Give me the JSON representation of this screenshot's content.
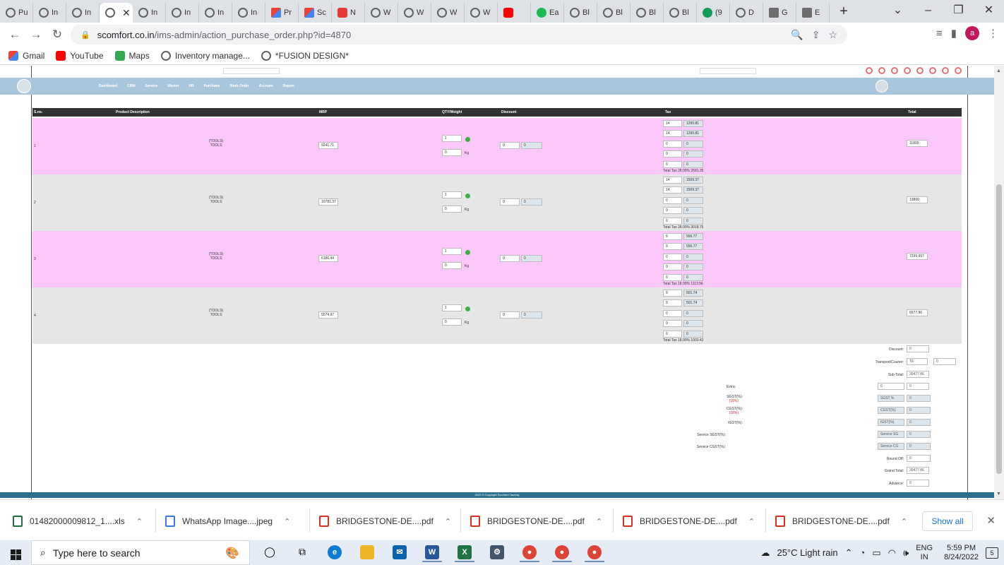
{
  "browser": {
    "tabs": [
      {
        "label": "Pu",
        "icon": "globe-icon"
      },
      {
        "label": "In",
        "icon": "globe-icon"
      },
      {
        "label": "In",
        "icon": "globe-icon"
      },
      {
        "label": "",
        "icon": "globe-icon",
        "active": true
      },
      {
        "label": "In",
        "icon": "globe-icon"
      },
      {
        "label": "In",
        "icon": "globe-icon"
      },
      {
        "label": "In",
        "icon": "globe-icon"
      },
      {
        "label": "In",
        "icon": "globe-icon"
      },
      {
        "label": "Pr",
        "icon": "gmail-icon"
      },
      {
        "label": "Sc",
        "icon": "gmail-icon"
      },
      {
        "label": "N",
        "icon": "red-icon"
      },
      {
        "label": "W",
        "icon": "globe-icon"
      },
      {
        "label": "W",
        "icon": "globe-icon"
      },
      {
        "label": "W",
        "icon": "globe-icon"
      },
      {
        "label": "W",
        "icon": "globe-icon"
      },
      {
        "label": "",
        "icon": "youtube-icon"
      },
      {
        "label": "Ea",
        "icon": "green-icon"
      },
      {
        "label": "Bl",
        "icon": "globe-icon"
      },
      {
        "label": "Bl",
        "icon": "globe-icon"
      },
      {
        "label": "Bl",
        "icon": "globe-icon"
      },
      {
        "label": "Bl",
        "icon": "globe-icon"
      },
      {
        "label": "(9",
        "icon": "dgreen-icon"
      },
      {
        "label": "D",
        "icon": "globe-icon"
      },
      {
        "label": "G",
        "icon": "bank-icon"
      },
      {
        "label": "E",
        "icon": "list-icon"
      }
    ],
    "url_domain": "scomfort.co.in",
    "url_path": "/ims-admin/action_purchase_order.php?id=4870",
    "bookmarks": [
      {
        "label": "Gmail",
        "icon": "gmail-icon"
      },
      {
        "label": "YouTube",
        "icon": "youtube-icon"
      },
      {
        "label": "Maps",
        "icon": "maps-icon"
      },
      {
        "label": "Inventory manage...",
        "icon": "globe-icon"
      },
      {
        "label": "*FUSION DESIGN*",
        "icon": "globe-icon"
      }
    ]
  },
  "page": {
    "nav_items": [
      "Dashboard",
      "CRM",
      "Service",
      "Master",
      "HR",
      "Purchase",
      "Work Order",
      "Account",
      "Report"
    ],
    "table_headers": {
      "sno": "S.no.",
      "desc": "Product Description",
      "mrp": "MRP",
      "qty": "QTY/Weight",
      "discount": "Discount",
      "tax": "Tax",
      "total": "Total"
    },
    "rows": [
      {
        "sno": "1",
        "desc1": "(TOOLS)",
        "desc2": "TOOLS",
        "mrp": "9241.71",
        "qty": "1",
        "weight": "0",
        "unit": "Kg",
        "disc": "0",
        "disc_amt": "0",
        "tax": [
          [
            "14",
            "1290.81"
          ],
          [
            "14",
            "1290.81"
          ],
          [
            "0",
            "0"
          ],
          [
            "0",
            "0"
          ],
          [
            "0",
            "0"
          ]
        ],
        "total_tax": "Total Tax 28.00% 2581.35",
        "total": "11800"
      },
      {
        "sno": "2",
        "desc1": "(TOOLS)",
        "desc2": "TOOLS",
        "mrp": "10781.37",
        "qty": "1",
        "weight": "0",
        "unit": "Kg",
        "disc": "0",
        "disc_amt": "0",
        "tax": [
          [
            "14",
            "1509.37"
          ],
          [
            "14",
            "1509.37"
          ],
          [
            "0",
            "0"
          ],
          [
            "0",
            "0"
          ],
          [
            "0",
            "0"
          ]
        ],
        "total_tax": "Total Tax 28.00% 3018.75",
        "total": "13800"
      },
      {
        "sno": "3",
        "desc1": "(TOOLS)",
        "desc2": "TOOLS",
        "mrp": "6186.44",
        "qty": "1",
        "weight": "0",
        "unit": "Kg",
        "disc": "0",
        "disc_amt": "0",
        "tax": [
          [
            "9",
            "556.77"
          ],
          [
            "9",
            "556.77"
          ],
          [
            "0",
            "0"
          ],
          [
            "0",
            "0"
          ],
          [
            "0",
            "0"
          ]
        ],
        "total_tax": "Total Tax 18.00% 1113.56",
        "total": "7299.997"
      },
      {
        "sno": "4",
        "desc1": "(TOOLS)",
        "desc2": "TOOLS",
        "mrp": "5574.97",
        "qty": "1",
        "weight": "0",
        "unit": "Kg",
        "disc": "0",
        "disc_amt": "0",
        "tax": [
          [
            "9",
            "501.74"
          ],
          [
            "9",
            "501.74"
          ],
          [
            "0",
            "0"
          ],
          [
            "0",
            "0"
          ],
          [
            "0",
            "0"
          ]
        ],
        "total_tax": "Total Tax 18.00% 1003.42",
        "total": "6577.86"
      }
    ],
    "summary": {
      "discount_label": "Discount:",
      "discount_value": "0",
      "transport_label": "Transport/Courier:",
      "transport_select": "TE",
      "transport_value": "0",
      "subtotal_label": "Sub Total:",
      "subtotal_value": "39477.86",
      "extra_label": "Extra:",
      "extra_pct": "0",
      "extra_value": "0",
      "sgst_label": "SGST(%):",
      "sgst_sub": "(18%)",
      "sgst_pct": "SGST %",
      "sgst_value": "0",
      "cgst_label": "CGST(%):",
      "cgst_sub": "(18%)",
      "cgst_pct": "CGST(%)",
      "cgst_value": "0",
      "igst_label": "IGST(%):",
      "igst_pct": "IGST(%)",
      "igst_value": "0",
      "svc_sgst_label": "Service SGST(%):",
      "svc_sgst_pct": "Service SG",
      "svc_sgst_value": "0",
      "svc_cgst_label": "Service CGST(%):",
      "svc_cgst_pct": "Service CG",
      "svc_cgst_value": "0",
      "roundoff_label": "Round Off:",
      "roundoff_value": "0",
      "grandtotal_label": "Grand Total:",
      "grandtotal_value": "39477.86",
      "advance_label": "Advance:",
      "advance_value": "0"
    },
    "footer": "2022 © Copyright Scomfort Tasmay"
  },
  "downloads": [
    {
      "name": "01482000009812_1....xls",
      "icon": "excel-file-icon"
    },
    {
      "name": "WhatsApp Image....jpeg",
      "icon": "image-file-icon"
    },
    {
      "name": "BRIDGESTONE-DE....pdf",
      "icon": "pdf-file-icon"
    },
    {
      "name": "BRIDGESTONE-DE....pdf",
      "icon": "pdf-file-icon"
    },
    {
      "name": "BRIDGESTONE-DE....pdf",
      "icon": "pdf-file-icon"
    },
    {
      "name": "BRIDGESTONE-DE....pdf",
      "icon": "pdf-file-icon"
    }
  ],
  "download_show_all": "Show all",
  "taskbar": {
    "search_placeholder": "Type here to search",
    "weather": "25°C  Light rain",
    "lang1": "ENG",
    "lang2": "IN",
    "time": "5:59 PM",
    "date": "8/24/2022",
    "notif_count": "5"
  },
  "colors": {
    "row_pink": "#fcc8fc",
    "row_grey": "#e6e6e6",
    "nav_band": "#a9c7dc",
    "table_header": "#333333",
    "footer": "#2d6f8f"
  }
}
